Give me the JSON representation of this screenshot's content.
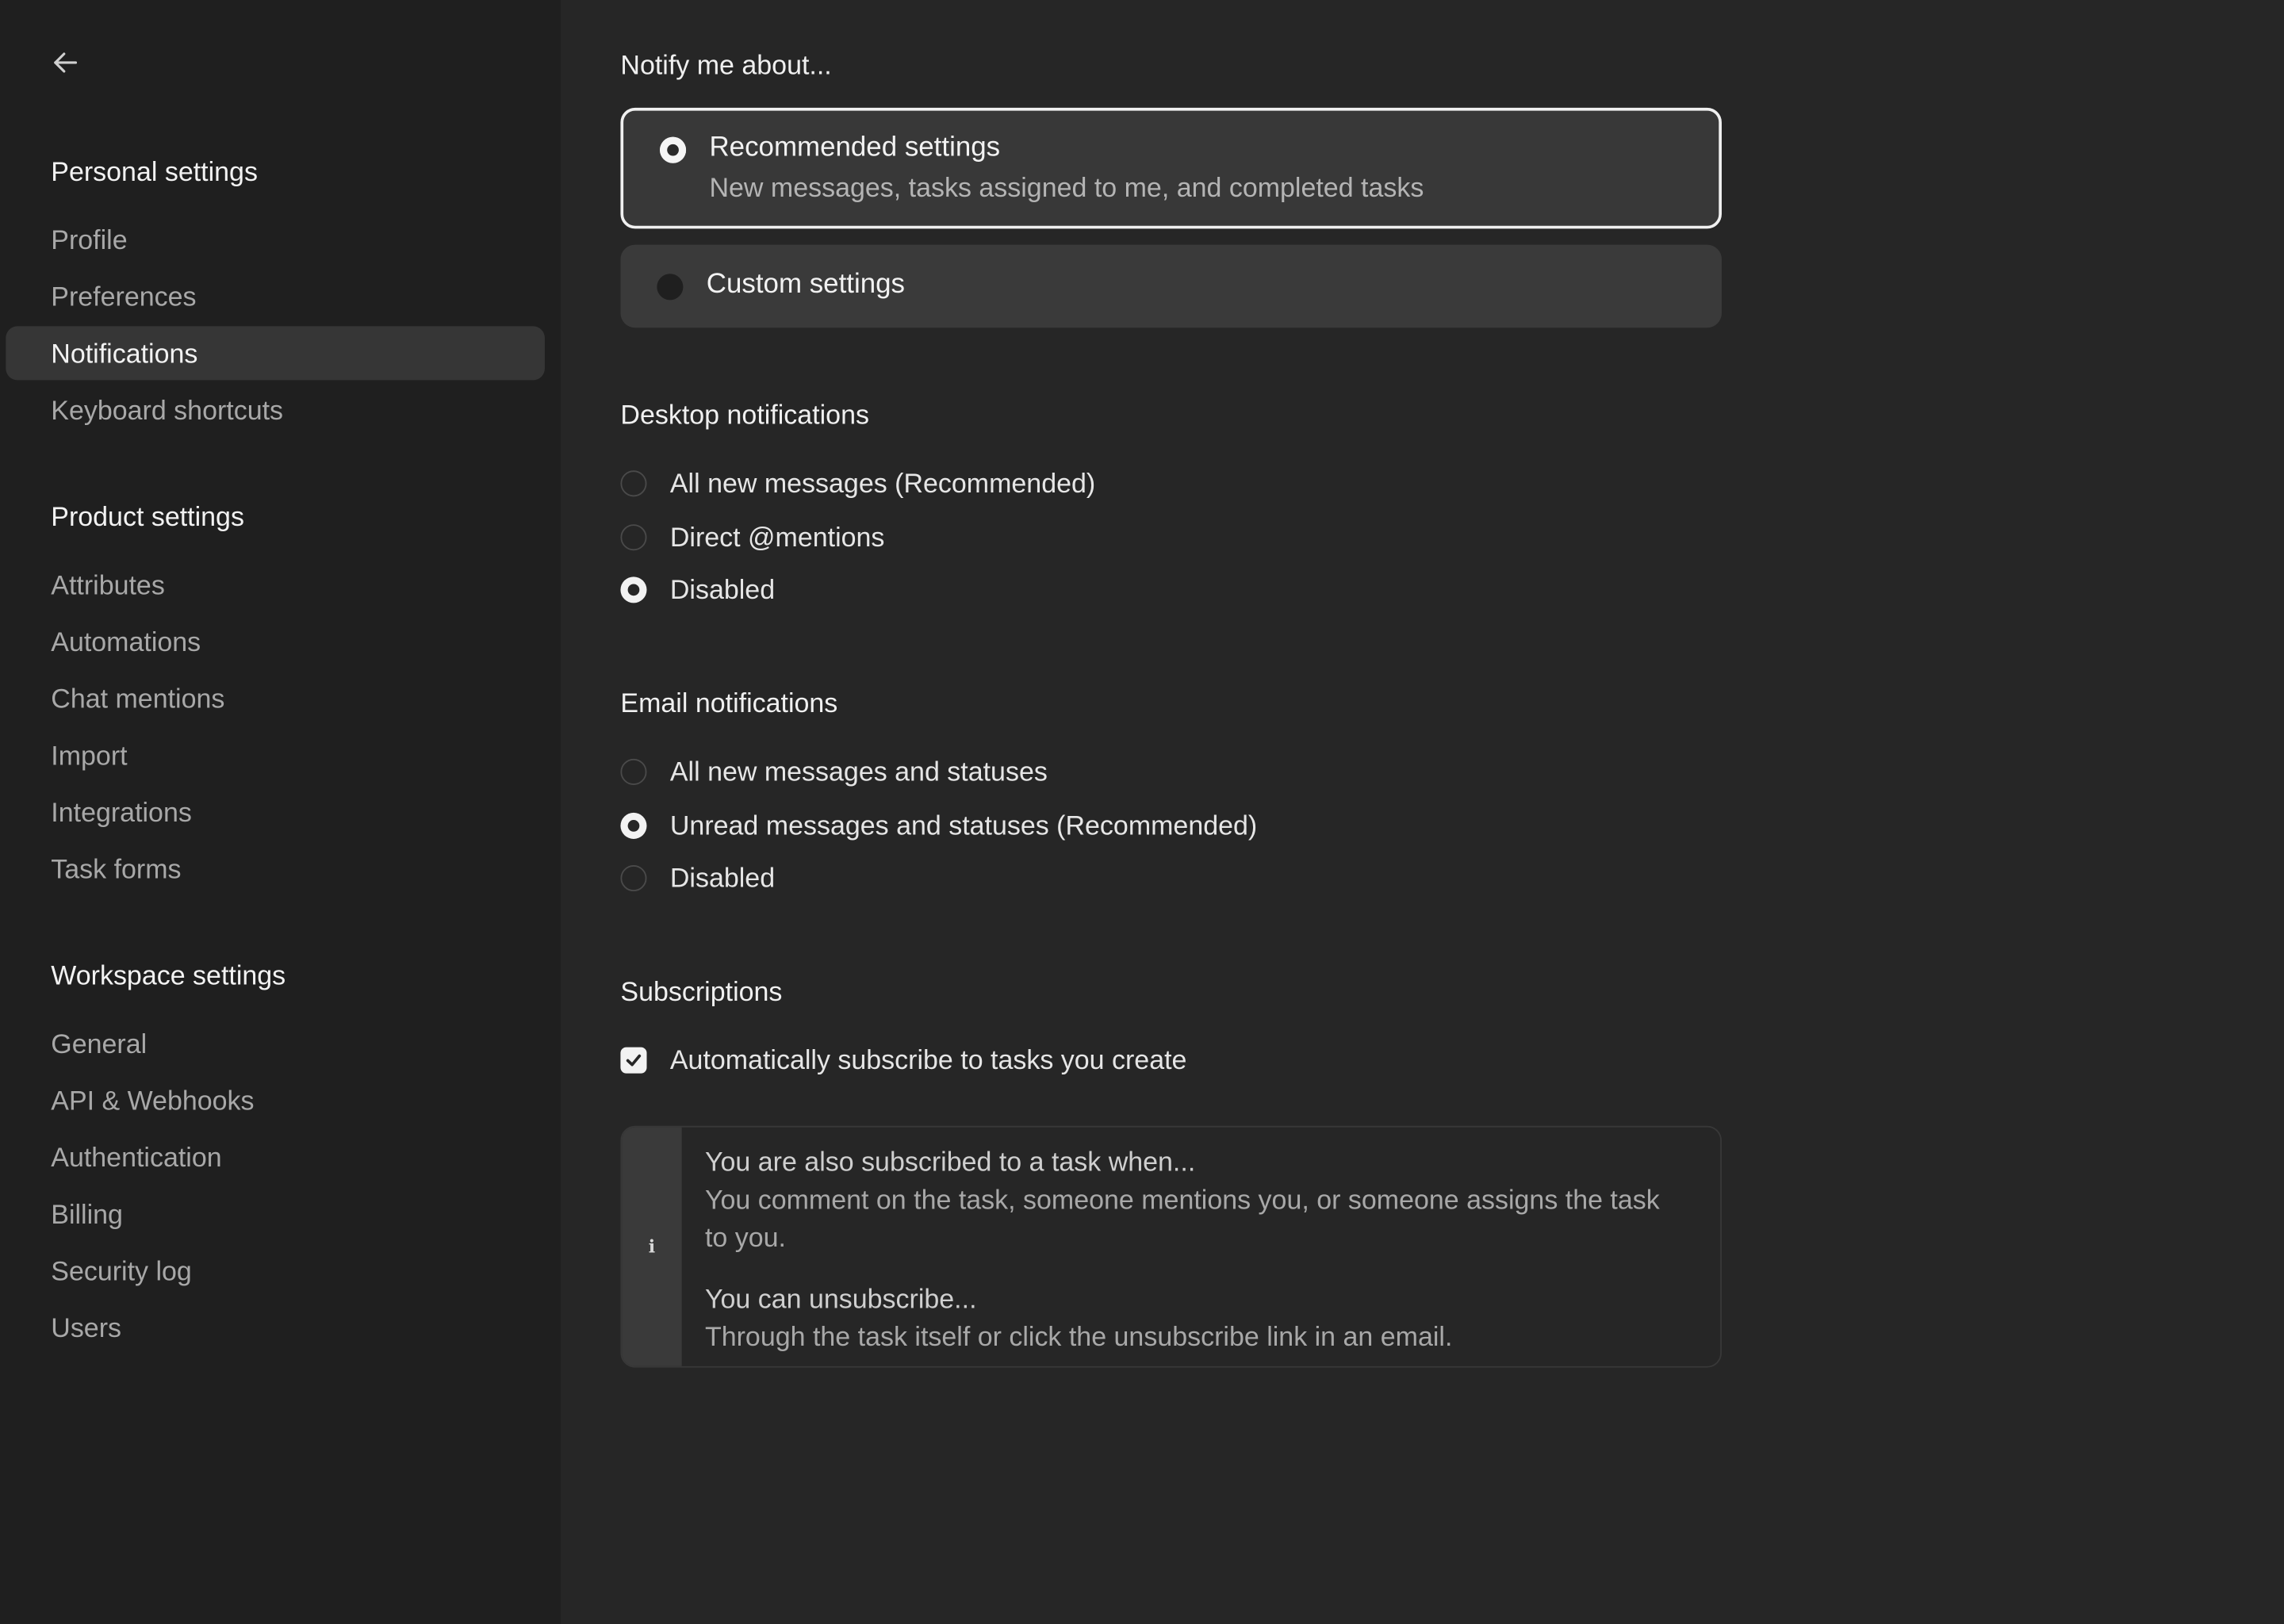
{
  "sidebar": {
    "back_icon": "arrow-left-icon",
    "personal": {
      "heading": "Personal settings",
      "items": [
        {
          "label": "Profile"
        },
        {
          "label": "Preferences"
        },
        {
          "label": "Notifications"
        },
        {
          "label": "Keyboard shortcuts"
        }
      ]
    },
    "product": {
      "heading": "Product settings",
      "items": [
        {
          "label": "Attributes"
        },
        {
          "label": "Automations"
        },
        {
          "label": "Chat mentions"
        },
        {
          "label": "Import"
        },
        {
          "label": "Integrations"
        },
        {
          "label": "Task forms"
        }
      ]
    },
    "workspace": {
      "heading": "Workspace settings",
      "items": [
        {
          "label": "General"
        },
        {
          "label": "API & Webhooks"
        },
        {
          "label": "Authentication"
        },
        {
          "label": "Billing"
        },
        {
          "label": "Security log"
        },
        {
          "label": "Users"
        }
      ]
    }
  },
  "main": {
    "notify": {
      "title": "Notify me about...",
      "recommended": {
        "title": "Recommended settings",
        "subtitle": "New messages, tasks assigned to me, and completed tasks",
        "selected": true
      },
      "custom": {
        "title": "Custom settings",
        "selected": false
      }
    },
    "desktop": {
      "title": "Desktop notifications",
      "options": [
        {
          "label": "All new messages (Recommended)",
          "selected": false
        },
        {
          "label": "Direct @mentions",
          "selected": false
        },
        {
          "label": "Disabled",
          "selected": true
        }
      ]
    },
    "email": {
      "title": "Email notifications",
      "options": [
        {
          "label": "All new messages and statuses",
          "selected": false
        },
        {
          "label": "Unread messages and statuses (Recommended)",
          "selected": true
        },
        {
          "label": "Disabled",
          "selected": false
        }
      ]
    },
    "subscriptions": {
      "title": "Subscriptions",
      "auto_subscribe": {
        "label": "Automatically subscribe to tasks you create",
        "checked": true
      },
      "info": {
        "icon": "info-icon",
        "icon_glyph": "i",
        "head1": "You are also subscribed to a task when...",
        "text1": "You comment on the task, someone mentions you, or someone assigns the task to you.",
        "head2": "You can unsubscribe...",
        "text2": "Through the task itself or click the unsubscribe link in an email."
      }
    }
  }
}
